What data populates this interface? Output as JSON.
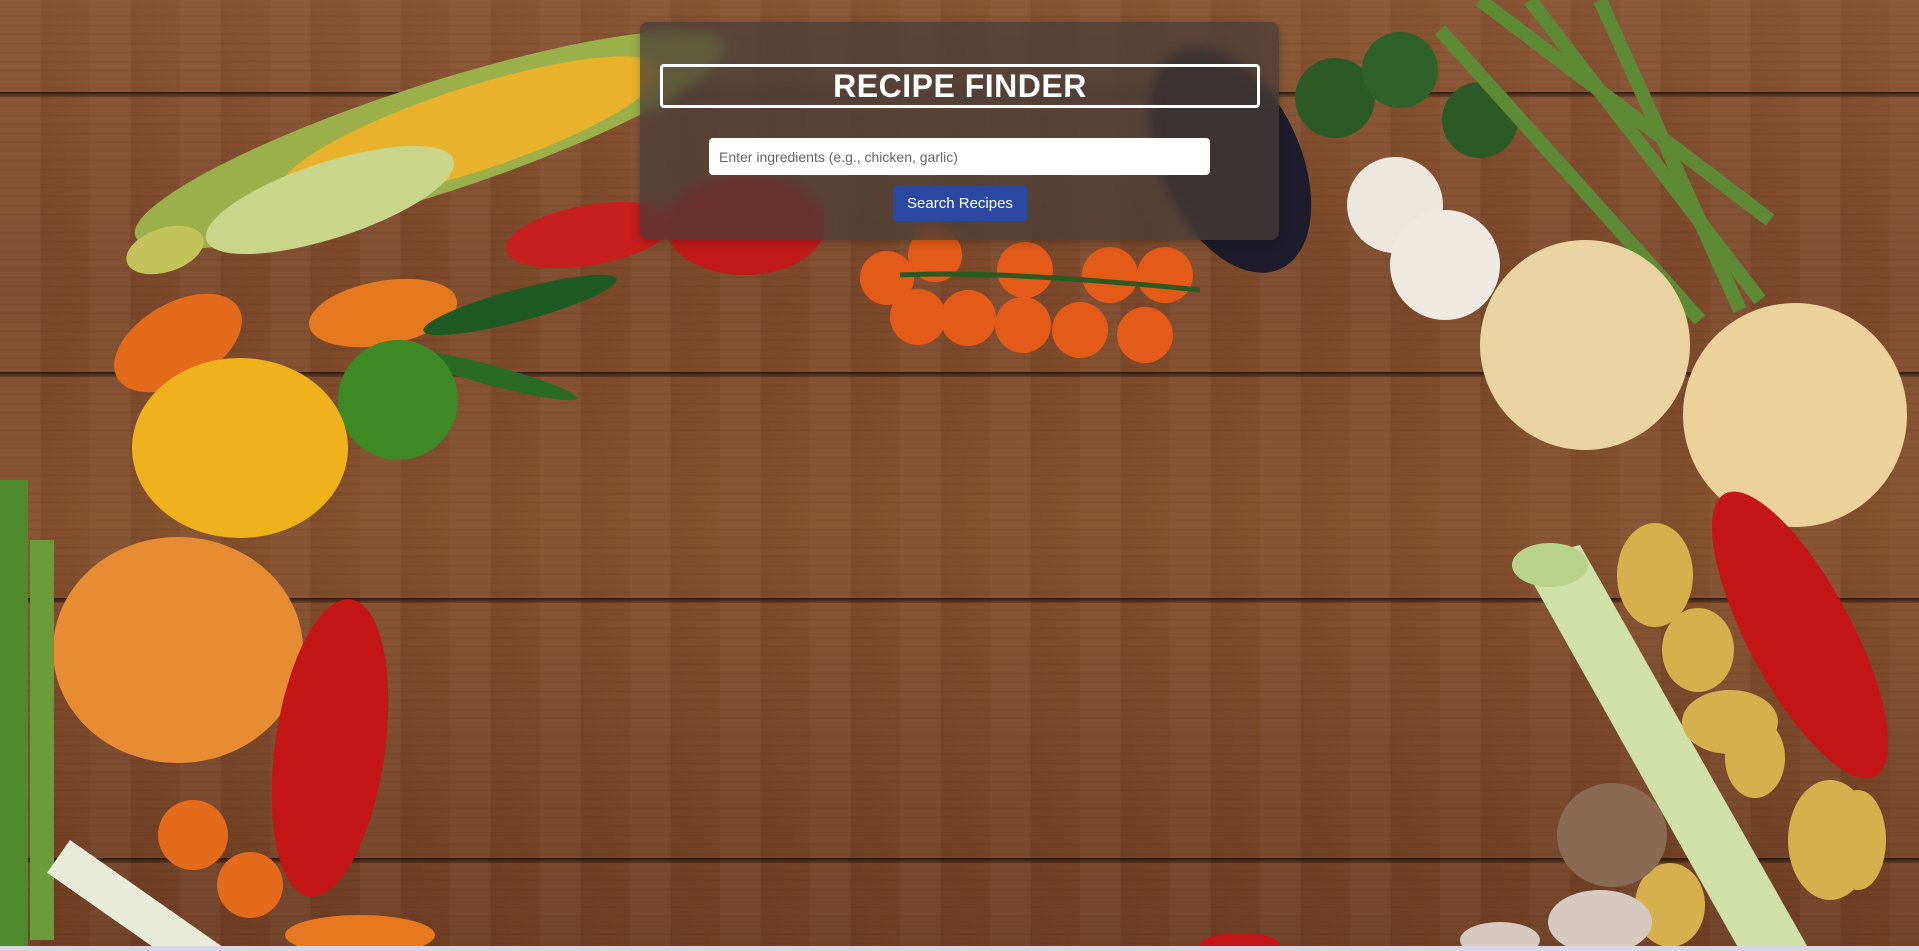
{
  "header": {
    "title": "RECIPE FINDER"
  },
  "search": {
    "placeholder": "Enter ingredients (e.g., chicken, garlic)",
    "value": "",
    "button_label": "Search Recipes"
  },
  "colors": {
    "panel_bg": "#463c37",
    "button_bg": "#2b48a0",
    "title_border": "#ffffff",
    "wood": "#86522f"
  },
  "background": {
    "description_icons": [
      "corn-icon",
      "pepper-icon",
      "tomato-icon",
      "garlic-icon",
      "onion-icon",
      "broccoli-icon",
      "asparagus-icon",
      "pumpkin-icon",
      "leek-icon",
      "potato-icon",
      "mushroom-icon",
      "lime-icon",
      "scallion-icon"
    ]
  }
}
